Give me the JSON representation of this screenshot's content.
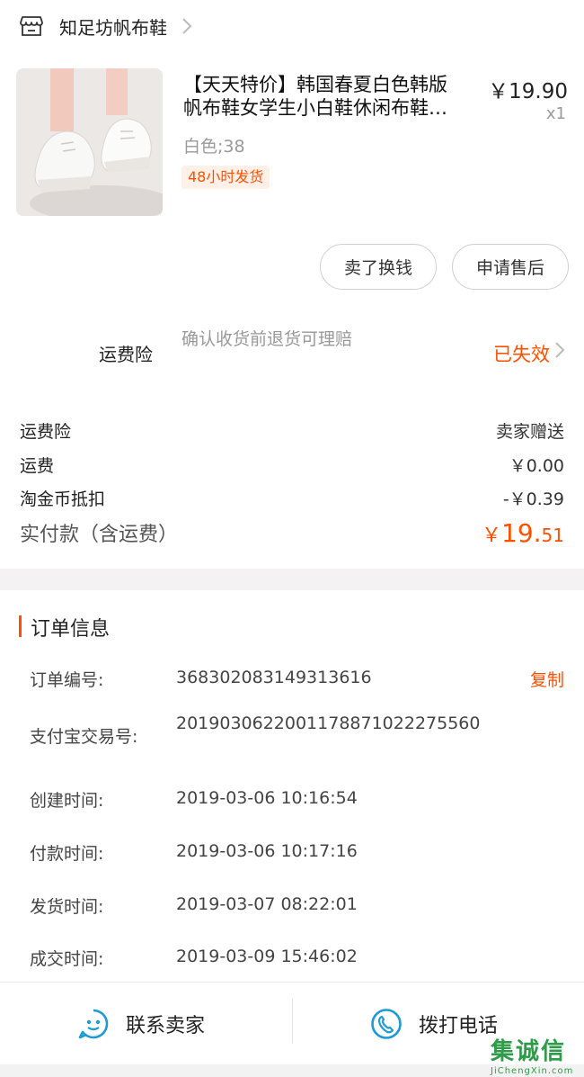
{
  "shop": {
    "name": "知足坊帆布鞋",
    "icon": "store-icon"
  },
  "product": {
    "title_line1": "【天天特价】韩国春夏白色韩版",
    "title_line2": "帆布鞋女学生小白鞋休闲布鞋…",
    "price": "￥19.90",
    "qty": "x1",
    "sku": "白色;38",
    "ship_badge": "48小时发货"
  },
  "actions": {
    "sell_label": "卖了换钱",
    "after_sale_label": "申请售后"
  },
  "insurance": {
    "label": "运费险",
    "desc": "确认收货前退货可理赔",
    "status": "已失效"
  },
  "fees": [
    {
      "label": "运费险",
      "value": "卖家赠送"
    },
    {
      "label": "运费",
      "value": "￥0.00"
    },
    {
      "label": "淘金币抵扣",
      "value": "-￥0.39"
    }
  ],
  "total": {
    "label": "实付款（含运费）",
    "currency": "￥",
    "integer": "19.",
    "decimal": "51"
  },
  "order_info": {
    "title": "订单信息",
    "copy_label": "复制",
    "rows": [
      {
        "label": "订单编号:",
        "value": "368302083149313616"
      },
      {
        "label": "支付宝交易号:",
        "value": "2019030622001178871022275560"
      },
      {
        "label": "创建时间:",
        "value": "2019-03-06 10:16:54"
      },
      {
        "label": "付款时间:",
        "value": "2019-03-06 10:17:16"
      },
      {
        "label": "发货时间:",
        "value": "2019-03-07 08:22:01"
      },
      {
        "label": "成交时间:",
        "value": "2019-03-09 15:46:02"
      }
    ]
  },
  "bottom": {
    "contact_label": "联系卖家",
    "call_label": "拨打电话"
  },
  "watermark": {
    "logo": "集诚信",
    "url": "JiChengXin.com"
  },
  "colors": {
    "accent": "#ff5000",
    "blue": "#1e9bd7",
    "muted": "#999999",
    "band": "#f5f2f4"
  }
}
